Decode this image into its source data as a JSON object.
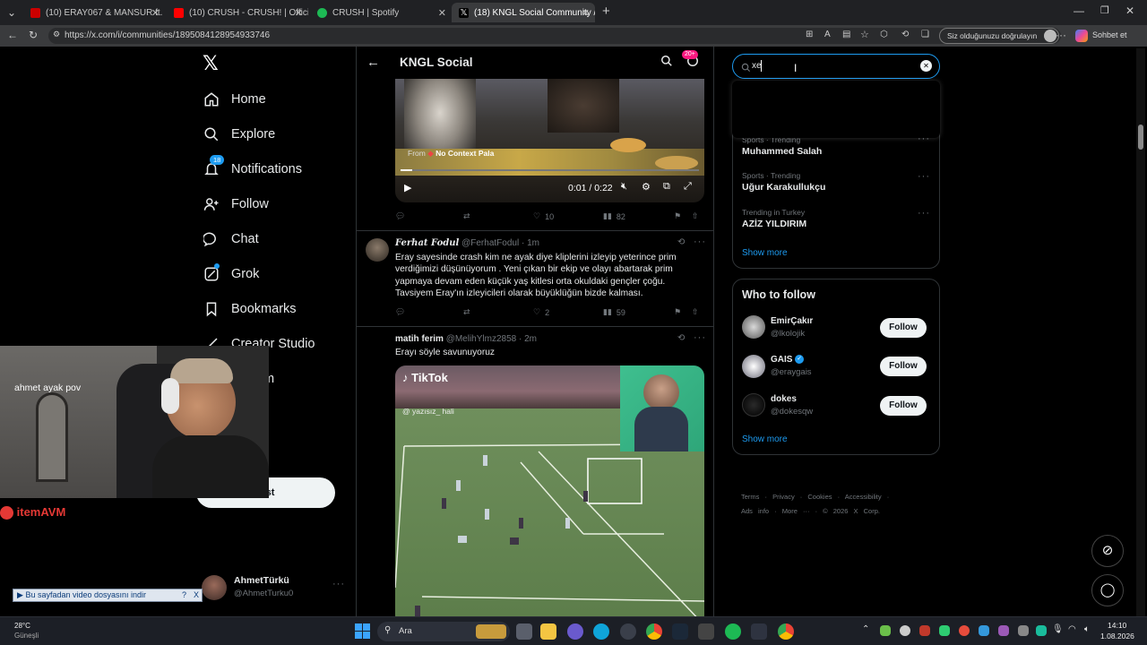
{
  "browser": {
    "tabs": [
      {
        "title": "(10) ERAY067 & MANSUR ft. Contr",
        "favicon": "youtube-icon",
        "color": "#cc0000"
      },
      {
        "title": "(10) CRUSH - CRUSH! | Official M",
        "favicon": "youtube-icon",
        "color": "#ff0000"
      },
      {
        "title": "CRUSH | Spotify",
        "favicon": "spotify-icon",
        "color": "#1db954"
      },
      {
        "title": "(18) KNGL Social Community / X",
        "favicon": "x-icon",
        "color": "#ffffff"
      }
    ],
    "new_tab_label": "+",
    "url": "https://x.com/i/communities/1895084128954933746",
    "verify_label": "Siz olduğunuzu doğrulayın",
    "copilot_label": "Sohbet et"
  },
  "sidebar": {
    "items": [
      {
        "label": "Home",
        "icon": "home-icon"
      },
      {
        "label": "Explore",
        "icon": "search-icon"
      },
      {
        "label": "Notifications",
        "icon": "bell-icon",
        "badge": "18"
      },
      {
        "label": "Follow",
        "icon": "add-person-icon"
      },
      {
        "label": "Chat",
        "icon": "chat-icon"
      },
      {
        "label": "Grok",
        "icon": "grok-icon"
      },
      {
        "label": "Bookmarks",
        "icon": "bookmark-icon"
      },
      {
        "label": "Creator Studio",
        "icon": "creator-icon"
      },
      {
        "label": "m",
        "icon": "premium-icon"
      }
    ],
    "post_button_label": "st",
    "account": {
      "name": "AhmetTürkü",
      "handle": "@AhmetTurku0",
      "more": "···"
    }
  },
  "header": {
    "title": "KNGL Social",
    "badge": "20+"
  },
  "posts": [
    {
      "media_source_label": "From",
      "media_source_name": "No Context Pala",
      "time_display": "0:01 / 0:22",
      "likes": "10",
      "views": "82"
    },
    {
      "name": "Ferhat Fodul",
      "handle": "@FerhatFodul",
      "time": "· 1m",
      "text": "Eray sayesinde crash kim ne ayak diye kliplerini izleyip yeterince prim verdiğimizi düşünüyorum . Yeni çıkan bir ekip ve olayı abartarak prim yapmaya devam eden küçük yaş kitlesi orta okuldaki gençler çoğu. Tavsiyem Eray'ın izleyicileri olarak büyüklüğün bizde kalması.",
      "likes": "2",
      "views": "59"
    },
    {
      "name": "matih ferim",
      "handle": "@MelihYlmz2858",
      "time": "· 2m",
      "text": "Erayı söyle savunuyoruz",
      "tiktok_label": "TikTok",
      "tiktok_user": "@ yazısız_ hali"
    }
  ],
  "search": {
    "value": "xe"
  },
  "trends": [
    {
      "meta": "Sports · Trending",
      "name": "Muhammed Salah"
    },
    {
      "meta": "Sports · Trending",
      "name": "Uğur Karakullukçu"
    },
    {
      "meta": "Trending in Turkey",
      "name": "AZİZ YILDIRIM"
    }
  ],
  "trends_show_more": "Show more",
  "who_to_follow": {
    "title": "Who to follow",
    "users": [
      {
        "name": "EmirÇakır",
        "handle": "@lkolojik",
        "button": "Follow",
        "verified": false
      },
      {
        "name": "GAIS",
        "handle": "@eraygais",
        "button": "Follow",
        "verified": true
      },
      {
        "name": "dokes",
        "handle": "@dokesqw",
        "button": "Follow",
        "verified": false
      }
    ],
    "show_more": "Show more"
  },
  "footer": {
    "links": [
      "Terms",
      "·",
      "Privacy",
      "·",
      "Cookies",
      "·",
      "Accessibility",
      "·"
    ],
    "links2": [
      "Ads info",
      "·",
      "More ···",
      "·",
      "© 2026 X Corp."
    ]
  },
  "overlay": {
    "webcam_text": "ahmet ayak pov",
    "sponsor": "itemAVM",
    "download_bar": "Bu sayfadan video dosyasını indir",
    "download_help": "?",
    "download_close": "X"
  },
  "taskbar": {
    "weather_temp": "28°C",
    "weather_desc": "Güneşli",
    "search_placeholder": "Ara",
    "time": "14:10",
    "date": "1.08.2026"
  },
  "colors": {
    "x_blue": "#1d9bf0",
    "badge_pink": "#f91880",
    "follow_bg": "#eff3f4"
  }
}
